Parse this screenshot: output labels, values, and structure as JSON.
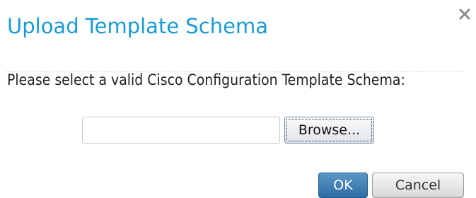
{
  "dialog": {
    "title": "Upload Template Schema",
    "close_icon": "close-icon",
    "prompt": "Please select a valid Cisco Configuration Template Schema:",
    "file_input": {
      "value": "",
      "placeholder": ""
    },
    "browse_label": "Browse...",
    "ok_label": "OK",
    "cancel_label": "Cancel"
  },
  "colors": {
    "title": "#1a9ad6",
    "primary_button": "#2d6da3",
    "close_icon": "#8a8a8a"
  }
}
